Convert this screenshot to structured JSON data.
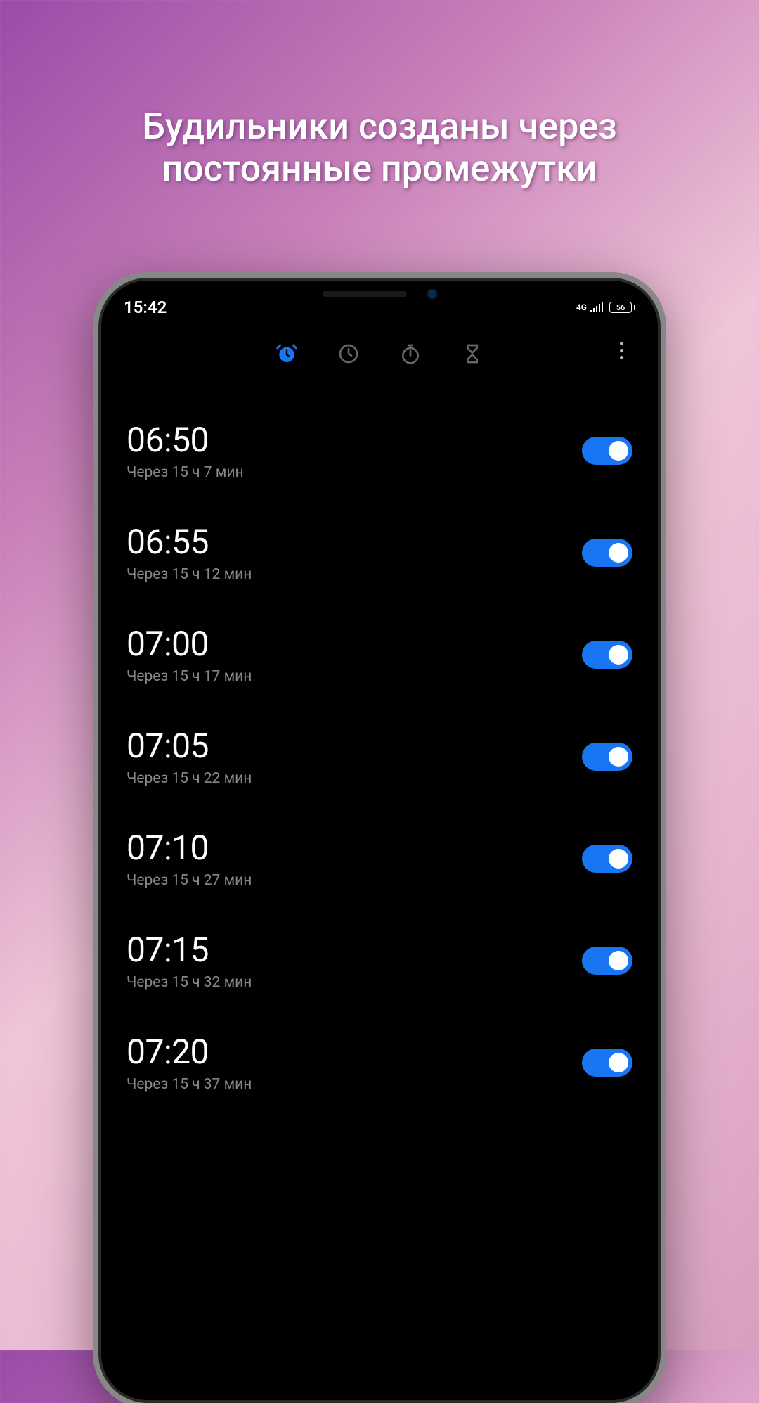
{
  "promo": {
    "title": "Будильники созданы через постоянные промежутки"
  },
  "statusBar": {
    "time": "15:42",
    "network": "4G",
    "battery": "56"
  },
  "tabs": {
    "alarm": "alarm",
    "clock": "clock",
    "stopwatch": "stopwatch",
    "timer": "timer",
    "activeIndex": 0
  },
  "colors": {
    "accent": "#1976f2",
    "inactive": "#666"
  },
  "alarms": [
    {
      "time": "06:50",
      "subtitle": "Через 15 ч 7 мин",
      "enabled": true
    },
    {
      "time": "06:55",
      "subtitle": "Через 15 ч 12 мин",
      "enabled": true
    },
    {
      "time": "07:00",
      "subtitle": "Через 15 ч 17 мин",
      "enabled": true
    },
    {
      "time": "07:05",
      "subtitle": "Через 15 ч 22 мин",
      "enabled": true
    },
    {
      "time": "07:10",
      "subtitle": "Через 15 ч 27 мин",
      "enabled": true
    },
    {
      "time": "07:15",
      "subtitle": "Через 15 ч 32 мин",
      "enabled": true
    },
    {
      "time": "07:20",
      "subtitle": "Через 15 ч 37 мин",
      "enabled": true
    }
  ]
}
